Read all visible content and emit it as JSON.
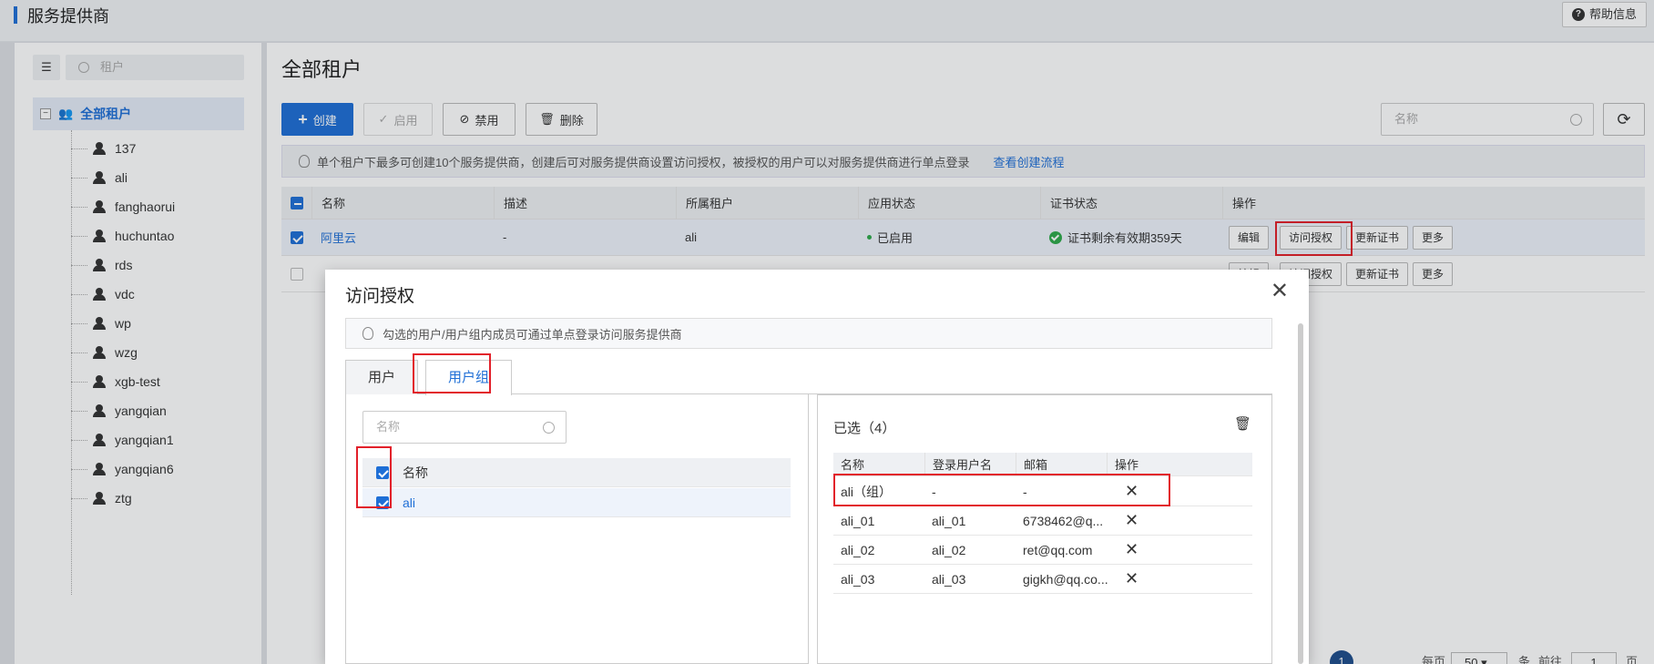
{
  "header": {
    "title": "服务提供商",
    "help_label": "帮助信息"
  },
  "tree": {
    "search_placeholder": "租户",
    "root_label": "全部租户",
    "items": [
      "137",
      "ali",
      "fanghaorui",
      "huchuntao",
      "rds",
      "vdc",
      "wp",
      "wzg",
      "xgb-test",
      "yangqian",
      "yangqian1",
      "yangqian6",
      "ztg"
    ]
  },
  "main": {
    "title": "全部租户",
    "toolbar": {
      "create": "创建",
      "enable": "启用",
      "disable": "禁用",
      "delete": "删除",
      "search_placeholder": "名称"
    },
    "notice": {
      "text": "单个租户下最多可创建10个服务提供商，创建后可对服务提供商设置访问授权，被授权的用户可以对服务提供商进行单点登录",
      "link": "查看创建流程"
    },
    "table": {
      "columns": [
        "名称",
        "描述",
        "所属租户",
        "应用状态",
        "证书状态",
        "操作"
      ],
      "rows": [
        {
          "name": "阿里云",
          "desc": "-",
          "tenant": "ali",
          "status": "已启用",
          "cert": "证书剩余有效期359天"
        }
      ],
      "actions": [
        "编辑",
        "访问授权",
        "更新证书",
        "更多"
      ]
    }
  },
  "dialog": {
    "title": "访问授权",
    "notice": "勾选的用户/用户组内成员可通过单点登录访问服务提供商",
    "tabs": [
      "用户",
      "用户组"
    ],
    "left": {
      "search_placeholder": "名称",
      "header": "名称",
      "rows": [
        "ali"
      ]
    },
    "right": {
      "title": "已选（4）",
      "columns": [
        "名称",
        "登录用户名",
        "邮箱",
        "操作"
      ],
      "rows": [
        {
          "name": "ali（组）",
          "login": "-",
          "email": "-"
        },
        {
          "name": "ali_01",
          "login": "ali_01",
          "email": "6738462@q..."
        },
        {
          "name": "ali_02",
          "login": "ali_02",
          "email": "ret@qq.com"
        },
        {
          "name": "ali_03",
          "login": "ali_03",
          "email": "gigkh@qq.co..."
        }
      ]
    }
  },
  "pager": {
    "current": "1",
    "per_page_label": "每页",
    "per_page": "50",
    "unit": "条",
    "goto": "前往",
    "page_input": "1",
    "page_unit": "页"
  }
}
